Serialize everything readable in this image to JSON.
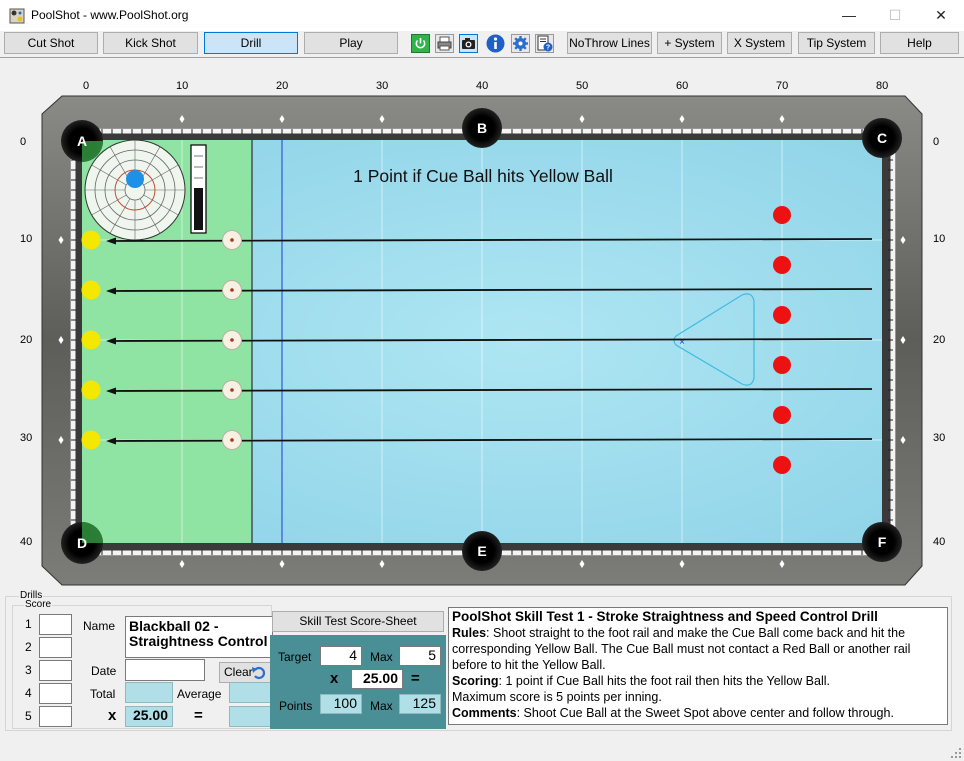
{
  "window": {
    "title": "PoolShot - www.PoolShot.org",
    "minimize_glyph": "—",
    "maximize_glyph": "☐",
    "close_glyph": "✕"
  },
  "toolbar": {
    "cut_shot": "Cut Shot",
    "kick_shot": "Kick Shot",
    "drill": "Drill",
    "play": "Play",
    "no_throw_lines": "NoThrow Lines",
    "plus_system": "+ System",
    "x_system": "X System",
    "tip_system": "Tip System",
    "help": "Help",
    "icons": [
      "power-icon",
      "print-icon",
      "camera-icon",
      "info-icon",
      "settings-gear-icon",
      "help-document-icon"
    ]
  },
  "table": {
    "message": "1 Point if Cue Ball hits Yellow Ball",
    "pockets": [
      "A",
      "B",
      "C",
      "D",
      "E",
      "F"
    ],
    "x_scale": [
      "0",
      "10",
      "20",
      "30",
      "40",
      "50",
      "60",
      "70",
      "80"
    ],
    "y_scale": [
      "0",
      "10",
      "20",
      "30",
      "40"
    ],
    "colors": {
      "cloth": "#9ad9ea",
      "kitchen": "#8fe3a3",
      "rail": "#6b6b6b",
      "yellow_ball": "#f5e800",
      "red_ball": "#ee1111",
      "cue_ball": "#f7f1e3",
      "rack": "#3fbbe0"
    },
    "rack_mark": "×"
  },
  "drills": {
    "legend": "Drills",
    "score": {
      "legend": "Score",
      "rows": [
        "1",
        "2",
        "3",
        "4",
        "5"
      ],
      "name_label": "Name",
      "name_value": "Blackball 02 - Straightness Control",
      "date_label": "Date",
      "date_value": "",
      "clear_label": "Clear",
      "total_label": "Total",
      "average_label": "Average",
      "multiplier_sign": "x",
      "multiplier_value": "25.00",
      "equals_sign": "="
    },
    "sheet_button": "Skill Test Score-Sheet",
    "calc": {
      "target_label": "Target",
      "target_value": "4",
      "max_label": "Max",
      "max_value": "5",
      "multiplier_sign": "x",
      "multiplier_value": "25.00",
      "equals_sign": "=",
      "points_label": "Points",
      "points_value": "100",
      "max2_label": "Max",
      "max2_value": "125"
    },
    "description": {
      "title": "PoolShot Skill Test 1 - Stroke Straightness and Speed Control Drill",
      "rules_label": "Rules",
      "rules_text": ": Shoot straight to the foot rail and make the Cue Ball come back and hit the corresponding Yellow Ball. The Cue Ball must not contact a Red Ball or another rail before to hit the Yellow Ball.",
      "scoring_label": "Scoring",
      "scoring_text": ": 1 point if Cue Ball hits the foot rail then hits the Yellow Ball.",
      "max_text": "Maximum score is 5 points per inning.",
      "comments_label": "Comments",
      "comments_text": ": Shoot Cue Ball at the Sweet Spot above center and follow through."
    }
  }
}
